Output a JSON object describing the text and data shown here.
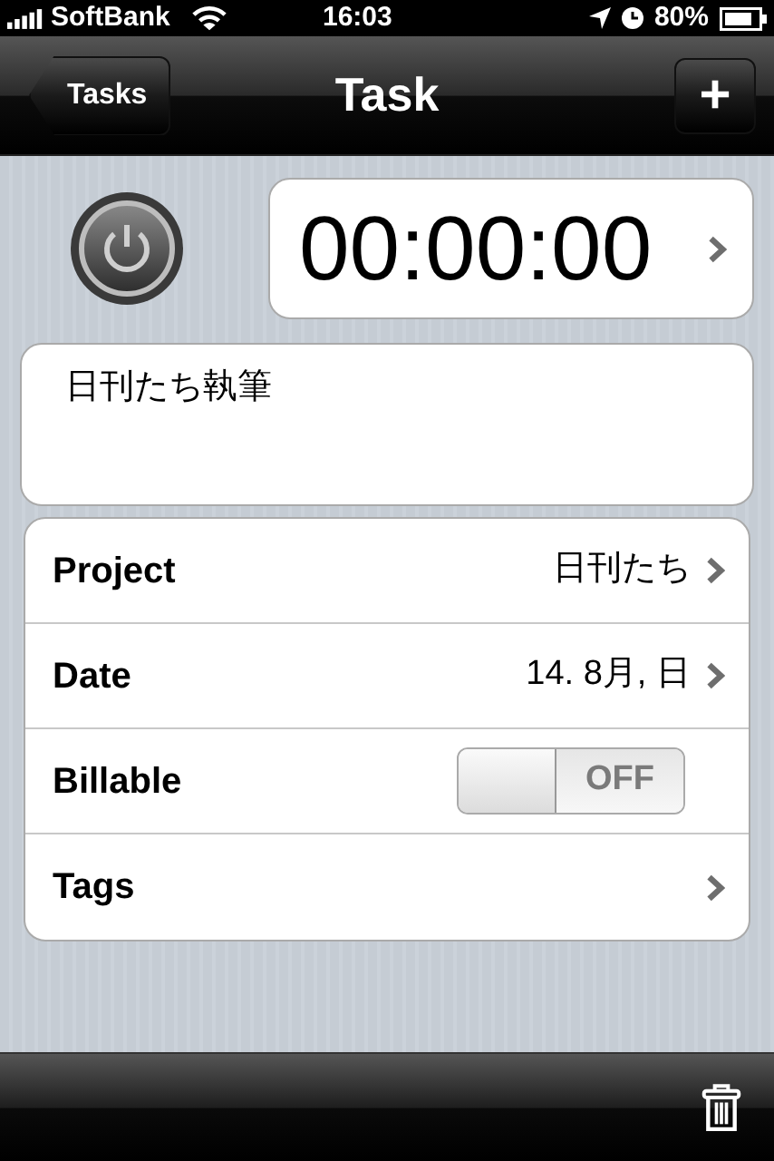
{
  "status_bar": {
    "carrier": "SoftBank",
    "time": "16:03",
    "battery": "80%"
  },
  "nav_bar": {
    "back_button": "Tasks",
    "title": "Task",
    "add_button": "+"
  },
  "timer": {
    "value": "00:00:00"
  },
  "note": "日刊たち執筆",
  "rows": [
    {
      "kind": "detail",
      "label": "Project",
      "value": "日刊たち"
    },
    {
      "kind": "detail",
      "label": "Date",
      "value": "14. 8月, 日"
    },
    {
      "kind": "switch",
      "label": "Billable",
      "on": false,
      "switch_label": "OFF"
    },
    {
      "kind": "detail",
      "label": "Tags"
    }
  ]
}
